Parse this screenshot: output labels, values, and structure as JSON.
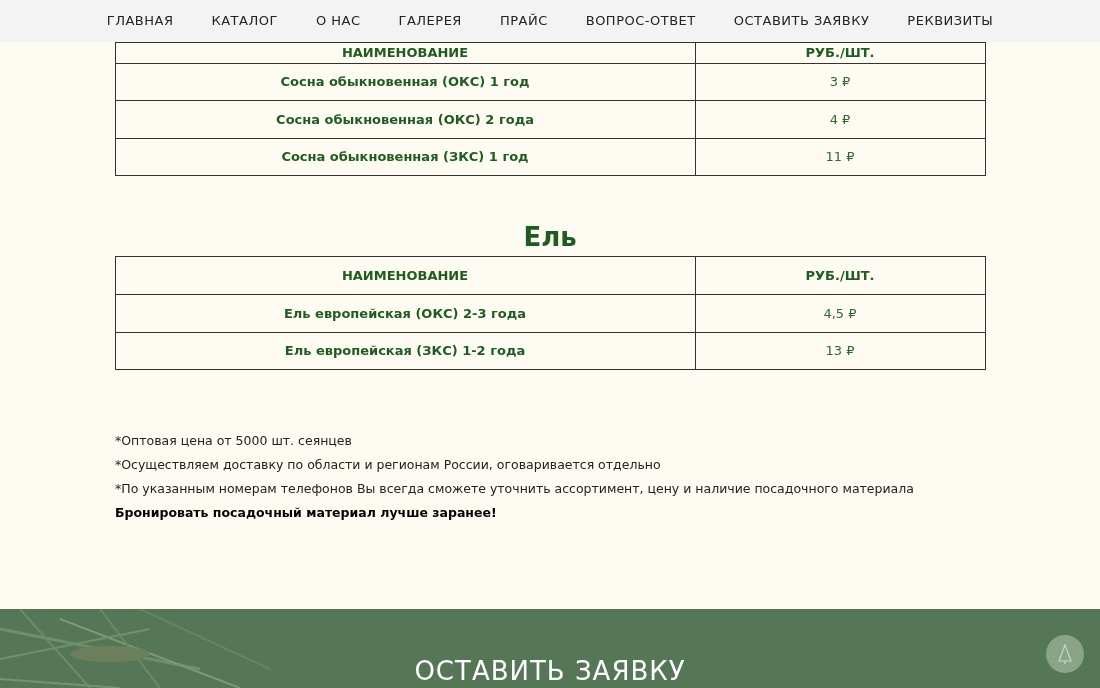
{
  "nav": [
    {
      "label": "ГЛАВНАЯ"
    },
    {
      "label": "КАТАЛОГ"
    },
    {
      "label": "О НАС"
    },
    {
      "label": "ГАЛЕРЕЯ"
    },
    {
      "label": "ПРАЙС"
    },
    {
      "label": "ВОПРОС-ОТВЕТ"
    },
    {
      "label": "ОСТАВИТЬ ЗАЯВКУ"
    },
    {
      "label": "РЕКВИЗИТЫ"
    }
  ],
  "sections": [
    {
      "columns": [
        "НАИМЕНОВАНИЕ",
        "РУБ./ШТ."
      ],
      "rows": [
        [
          "Сосна обыкновенная (ОКС) 1 год",
          "3 ₽"
        ],
        [
          "Сосна обыкновенная (ОКС) 2 года",
          "4 ₽"
        ],
        [
          "Сосна обыкновенная (ЗКС) 1 год",
          "11 ₽"
        ]
      ]
    },
    {
      "title": "Ель",
      "columns": [
        "НАИМЕНОВАНИЕ",
        "РУБ./ШТ."
      ],
      "rows": [
        [
          "Ель европейская (ОКС) 2-3 года",
          "4,5 ₽"
        ],
        [
          "Ель европейская (ЗКС) 1-2 года",
          "13 ₽"
        ]
      ]
    }
  ],
  "notes": [
    {
      "text": "*Оптовая цена от 5000 шт. сеянцев",
      "bold": false
    },
    {
      "text": "*Осуществляем доставку по области и регионам России, оговаривается отдельно",
      "bold": false
    },
    {
      "text": "*По указанным номерам телефонов Вы всегда сможете уточнить ассортимент, цену и наличие посадочного материала",
      "bold": false
    },
    {
      "text": "Бронировать посадочный материал лучше заранее!",
      "bold": true
    }
  ],
  "footer": {
    "title": "ОСТАВИТЬ ЗАЯВКУ"
  }
}
